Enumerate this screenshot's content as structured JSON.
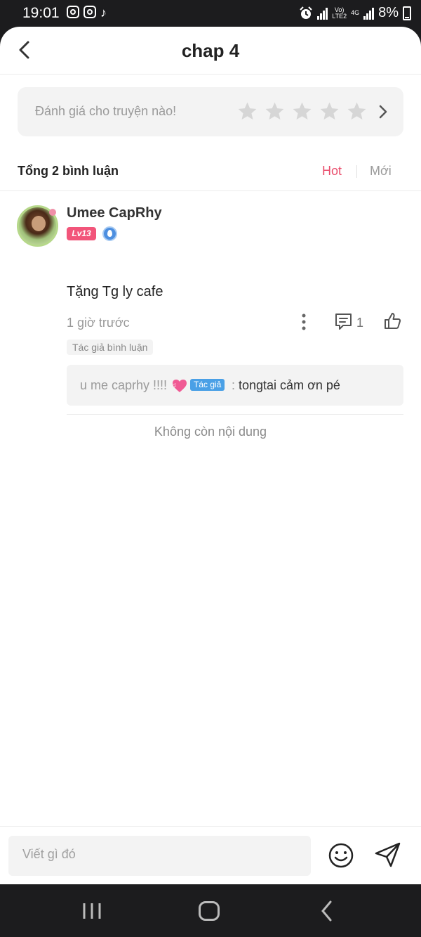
{
  "status_bar": {
    "time": "19:01",
    "network_top": "Vo)",
    "network_bottom": "LTE2",
    "network_type": "4G",
    "battery": "8%",
    "left_icons": [
      "instagram-icon",
      "instagram-icon",
      "tiktok-icon"
    ],
    "right_icons": [
      "alarm-icon",
      "signal-icon",
      "volte-icon",
      "signal-icon",
      "battery-charging-icon"
    ]
  },
  "header": {
    "title": "chap 4"
  },
  "rating": {
    "prompt": "Đánh giá cho truyện nào!",
    "stars_max": 5,
    "stars_filled": 0,
    "star_color": "#d6d6d6"
  },
  "comments_summary": {
    "total": "Tổng 2 bình luận",
    "sort_hot": "Hot",
    "sort_new": "Mới",
    "active_sort_color": "#e94c6b"
  },
  "comment": {
    "username": "Umee CapRhy",
    "level_badge": "Lv13",
    "text": "Tặng Tg ly cafe",
    "time": "1 giờ trước",
    "reply_count": "1",
    "author_tag": "Tác giả bình luận",
    "reply": {
      "author": "u me caprhy !!!!",
      "author_chip": "Tác giả",
      "separator": " : ",
      "body": "tongtai cảm ơn pé"
    }
  },
  "footer_note": "Không còn nội dung",
  "input": {
    "placeholder": "Viết gì đó"
  },
  "colors": {
    "accent": "#e94c6b",
    "level_badge": "#f2557a",
    "author_chip": "#4aa0e6"
  }
}
